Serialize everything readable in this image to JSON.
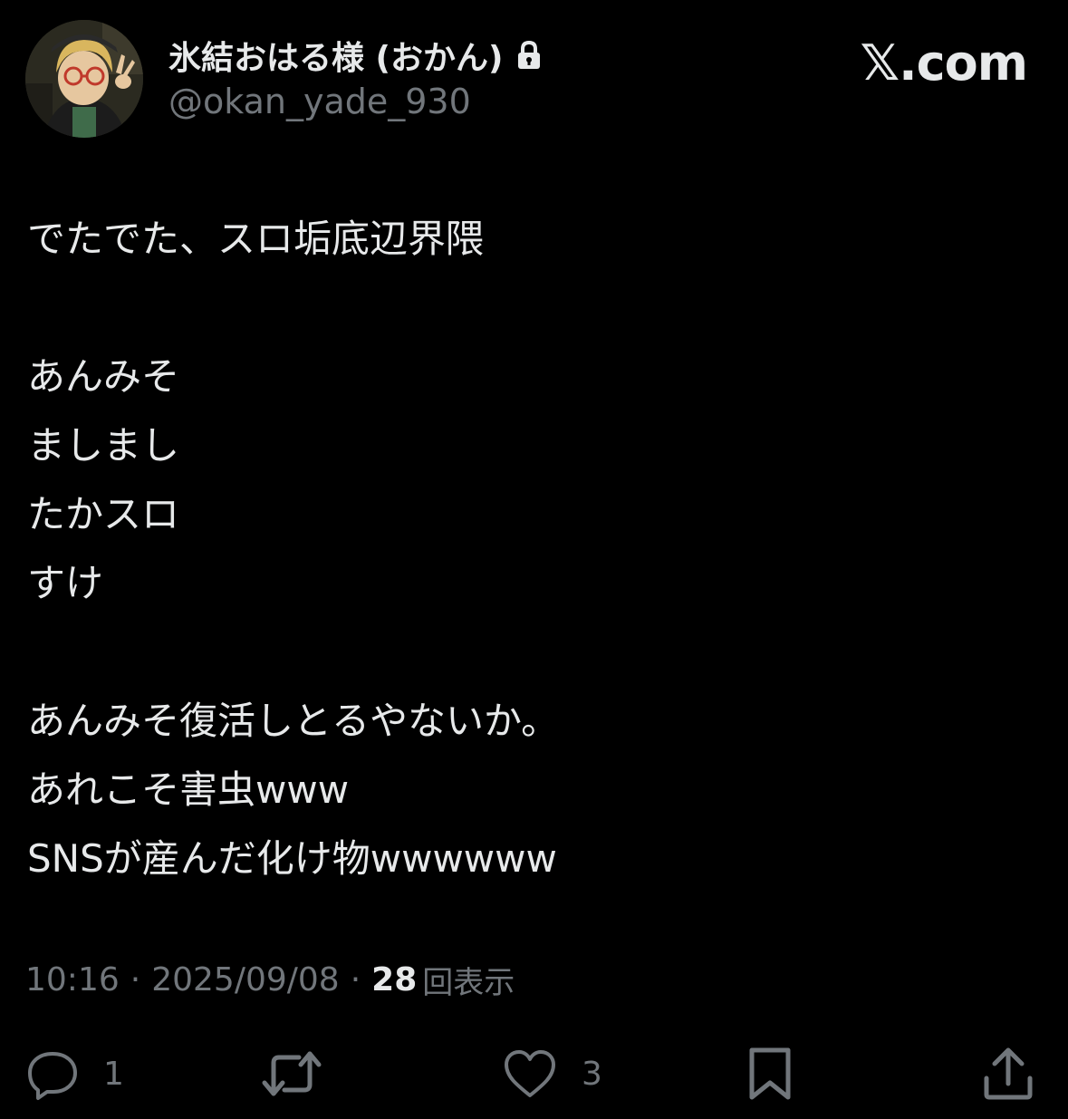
{
  "header": {
    "display_name": "氷結おはる様 (おかん)",
    "handle": "@okan_yade_930",
    "brand": "𝕏.com",
    "avatar_icon": "user-avatar-icon",
    "lock_icon": "lock-icon"
  },
  "tweet": {
    "lines": [
      "でたでた、スロ垢底辺界隈",
      "",
      "あんみそ",
      "ましまし",
      "たかスロ",
      "すけ",
      "",
      "あんみそ復活しとるやないか。",
      "あれこそ害虫www",
      "SNSが産んだ化け物wwwwww"
    ]
  },
  "meta": {
    "time": "10:16",
    "separator": "·",
    "date": "2025/09/08",
    "views_count": "28",
    "views_label": "回表示"
  },
  "actions": {
    "reply": {
      "icon": "reply-icon",
      "count": "1"
    },
    "retweet": {
      "icon": "retweet-icon",
      "count": ""
    },
    "like": {
      "icon": "heart-icon",
      "count": "3"
    },
    "bookmark": {
      "icon": "bookmark-icon"
    },
    "share": {
      "icon": "share-icon"
    }
  },
  "colors": {
    "background": "#000000",
    "primary_text": "#e7e9ea",
    "secondary_text": "#71767b"
  }
}
